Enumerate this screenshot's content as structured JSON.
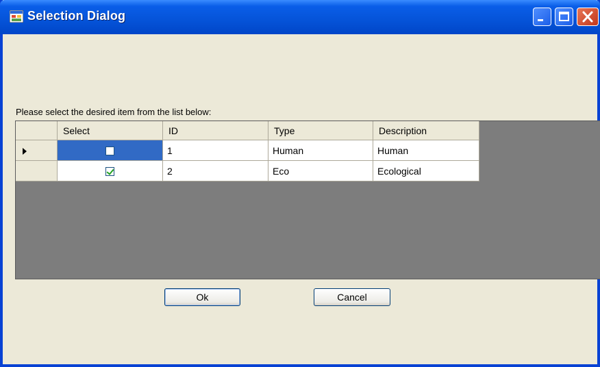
{
  "window": {
    "title": "Selection Dialog",
    "controls": [
      "minimize",
      "maximize",
      "close"
    ]
  },
  "prompt": "Please select the desired item from the list below:",
  "grid": {
    "columns": [
      "Select",
      "ID",
      "Type",
      "Description"
    ],
    "rows": [
      {
        "select": false,
        "id": "1",
        "type": "Human",
        "description": "Human",
        "current": true
      },
      {
        "select": true,
        "id": "2",
        "type": "Eco",
        "description": "Ecological",
        "current": false
      }
    ]
  },
  "buttons": {
    "ok": "Ok",
    "cancel": "Cancel"
  }
}
